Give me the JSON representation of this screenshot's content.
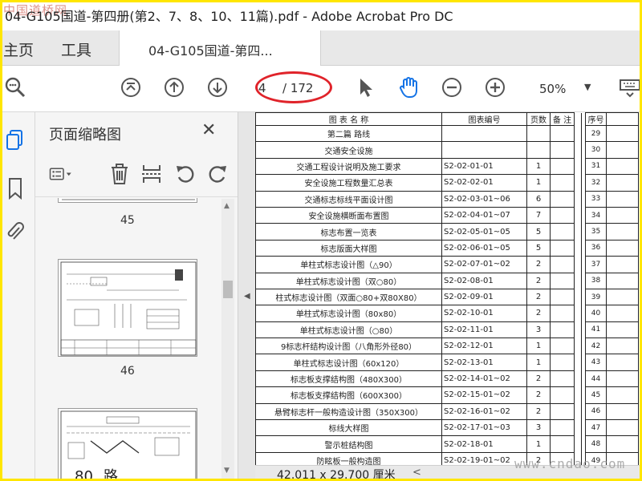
{
  "window": {
    "title": "04-G105国道-第四册(第2、7、8、10、11篇).pdf - Adobe Acrobat Pro DC",
    "watermark_top": "中国道桥网",
    "watermark_bottom": "www.cndao.com"
  },
  "tabs": {
    "home": "主页",
    "tools": "工具",
    "document": "04-G105国道-第四..."
  },
  "toolbar": {
    "current_page": "4",
    "total_pages": "/ 172",
    "zoom": "50%"
  },
  "thumbnails": {
    "title": "页面缩略图",
    "pages": [
      "45",
      "46"
    ]
  },
  "index_table": {
    "headers": {
      "name": "图 表 名 称",
      "code": "图表编号",
      "pages": "页数",
      "remark": "备 注",
      "seq": "序号"
    },
    "rows": [
      {
        "name": "第二篇  路线",
        "code": "",
        "pages": "",
        "seq": "29"
      },
      {
        "name": "交通安全设施",
        "code": "",
        "pages": "",
        "seq": "30"
      },
      {
        "name": "交通工程设计说明及施工要求",
        "code": "S2-02-01-01",
        "pages": "1",
        "seq": "31"
      },
      {
        "name": "安全设施工程数量汇总表",
        "code": "S2-02-02-01",
        "pages": "1",
        "seq": "32"
      },
      {
        "name": "交通标志标线平面设计图",
        "code": "S2-02-03-01~06",
        "pages": "6",
        "seq": "33"
      },
      {
        "name": "安全设施横断面布置图",
        "code": "S2-02-04-01~07",
        "pages": "7",
        "seq": "34"
      },
      {
        "name": "标志布置一览表",
        "code": "S2-02-05-01~05",
        "pages": "5",
        "seq": "35"
      },
      {
        "name": "标志版面大样图",
        "code": "S2-02-06-01~05",
        "pages": "5",
        "seq": "36"
      },
      {
        "name": "单柱式标志设计图（△90）",
        "code": "S2-02-07-01~02",
        "pages": "2",
        "seq": "37"
      },
      {
        "name": "单柱式标志设计图（双○80）",
        "code": "S2-02-08-01",
        "pages": "2",
        "seq": "38"
      },
      {
        "name": "柱式标志设计图（双面○80+双80X80）",
        "code": "S2-02-09-01",
        "pages": "2",
        "seq": "39"
      },
      {
        "name": "单柱式标志设计图（80x80）",
        "code": "S2-02-10-01",
        "pages": "2",
        "seq": "40"
      },
      {
        "name": "单柱式标志设计图（○80）",
        "code": "S2-02-11-01",
        "pages": "3",
        "seq": "41"
      },
      {
        "name": "9标志杆结构设计图（八角形外径80）",
        "code": "S2-02-12-01",
        "pages": "1",
        "seq": "42"
      },
      {
        "name": "单柱式标志设计图（60x120）",
        "code": "S2-02-13-01",
        "pages": "1",
        "seq": "43"
      },
      {
        "name": "标志板支撑结构图（480X300）",
        "code": "S2-02-14-01~02",
        "pages": "2",
        "seq": "44"
      },
      {
        "name": "标志板支撑结构图（600X300）",
        "code": "S2-02-15-01~02",
        "pages": "2",
        "seq": "45"
      },
      {
        "name": "悬臂标志杆一般构造设计图（350X300）",
        "code": "S2-02-16-01~02",
        "pages": "2",
        "seq": "46"
      },
      {
        "name": "标线大样图",
        "code": "S2-02-17-01~03",
        "pages": "3",
        "seq": "47"
      },
      {
        "name": "警示桩结构图",
        "code": "S2-02-18-01",
        "pages": "1",
        "seq": "48"
      },
      {
        "name": "防眩板一般构造图",
        "code": "S2-02-19-01~02",
        "pages": "2",
        "seq": "49"
      }
    ]
  },
  "statusbar": {
    "page_size": "42.011 x 29.700 厘米"
  },
  "colors": {
    "accent": "#1473e6",
    "frame": "#ffe600",
    "highlight": "#e0232a"
  }
}
